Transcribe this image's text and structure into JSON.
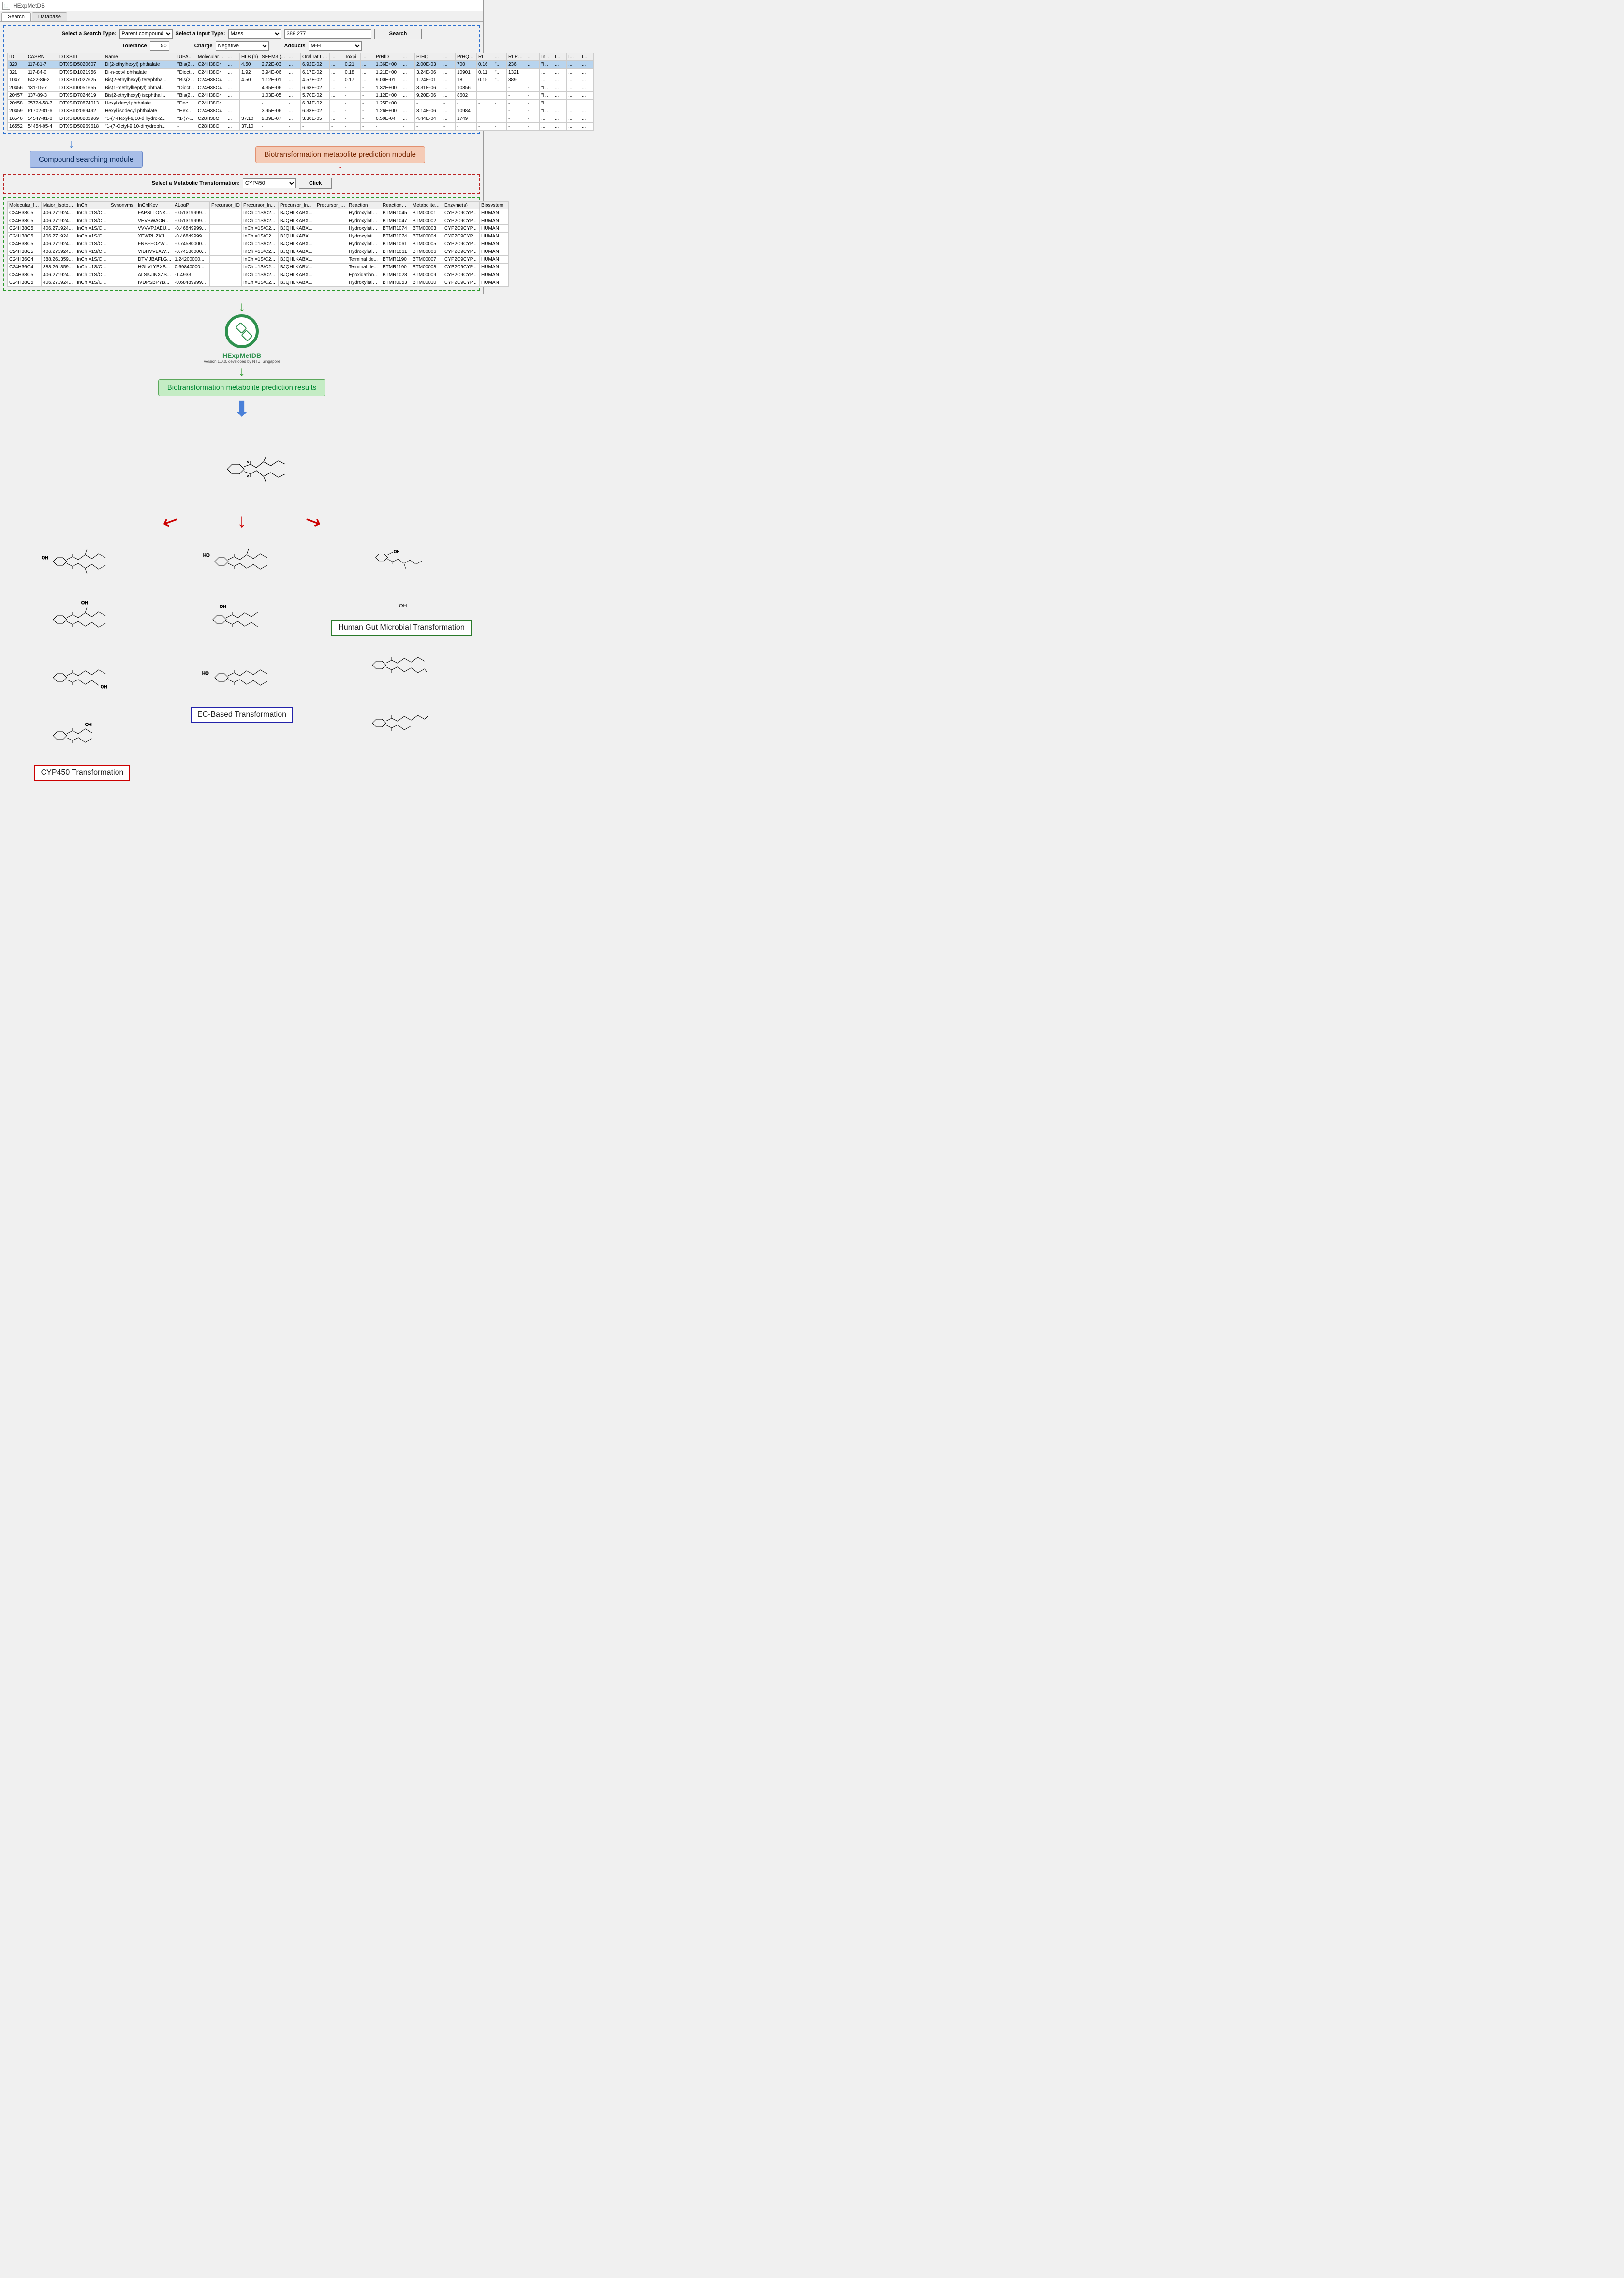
{
  "app": {
    "title": "HExpMetDB"
  },
  "tabs": {
    "search": "Search",
    "database": "Database"
  },
  "search": {
    "searchTypeLabel": "Select a Search Type:",
    "searchTypeValue": "Parent compound",
    "inputTypeLabel": "Select a Input Type:",
    "inputTypeValue": "Mass",
    "massValue": "389.277",
    "searchBtn": "Search",
    "tolLabel": "Tolerance",
    "tolValue": "50",
    "chargeLabel": "Charge",
    "chargeValue": "Negative",
    "adductsLabel": "Adducts",
    "adductsValue": "M-H"
  },
  "resultCols": [
    "ID",
    "CASRN",
    "DTXSID",
    "Name",
    "IUPA...",
    "Molecular f...",
    "...",
    "HLB (h)",
    "SEEM3 (...",
    "...",
    "Oral rat LD...",
    "...",
    "Toxpi",
    "...",
    "PrRfD",
    "...",
    "PrHQ",
    "...",
    "PrHQ...",
    "RI",
    "...",
    "RI Ra...",
    "...",
    "In...",
    "I...",
    "I...",
    "I..."
  ],
  "results": [
    {
      "id": "320",
      "cas": "117-81-7",
      "dtx": "DTXSID5020607",
      "name": "Di(2-ethylhexyl) phthalate",
      "iupa": "\"Bis(2...",
      "mf": "C24H38O4",
      "c7": "...",
      "hlb": "4.50",
      "seem": "2.72E-03",
      "c10": "...",
      "oral": "6.92E-02",
      "c12": "...",
      "toxpi": "0.21",
      "c14": "...",
      "prrfd": "1.36E+00",
      "c16": "...",
      "prhq": "2.00E-03",
      "c18": "...",
      "prhq2": "700",
      "ri": "0.16",
      "c21": "\"...",
      "rira": "236",
      "c23": "...",
      "i1": "\"I...",
      "i2": "...",
      "i3": "...",
      "i4": "..."
    },
    {
      "id": "321",
      "cas": "117-84-0",
      "dtx": "DTXSID1021956",
      "name": "Di-n-octyl phthalate",
      "iupa": "\"Dioct...",
      "mf": "C24H38O4",
      "c7": "...",
      "hlb": "1.92",
      "seem": "3.94E-06",
      "c10": "...",
      "oral": "6.17E-02",
      "c12": "...",
      "toxpi": "0.18",
      "c14": "...",
      "prrfd": "1.21E+00",
      "c16": "...",
      "prhq": "3.24E-06",
      "c18": "...",
      "prhq2": "10901",
      "ri": "0.11",
      "c21": "\"...",
      "rira": "1321",
      "c23": "",
      "i1": "...",
      "i2": "...",
      "i3": "...",
      "i4": "..."
    },
    {
      "id": "1047",
      "cas": "6422-86-2",
      "dtx": "DTXSID7027625",
      "name": "Bis(2-ethylhexyl) terephtha...",
      "iupa": "\"Bis(2...",
      "mf": "C24H38O4",
      "c7": "...",
      "hlb": "4.50",
      "seem": "1.12E-01",
      "c10": "...",
      "oral": "4.57E-02",
      "c12": "...",
      "toxpi": "0.17",
      "c14": "...",
      "prrfd": "9.00E-01",
      "c16": "...",
      "prhq": "1.24E-01",
      "c18": "...",
      "prhq2": "18",
      "ri": "0.15",
      "c21": "\"...",
      "rira": "389",
      "c23": "",
      "i1": "...",
      "i2": "...",
      "i3": "...",
      "i4": "..."
    },
    {
      "id": "20456",
      "cas": "131-15-7",
      "dtx": "DTXSID0051655",
      "name": "Bis(1-methylheptyl) phthal...",
      "iupa": "\"Dioct...",
      "mf": "C24H38O4",
      "c7": "...",
      "hlb": "",
      "seem": "4.35E-06",
      "c10": "...",
      "oral": "6.68E-02",
      "c12": "...",
      "toxpi": "-",
      "c14": "-",
      "prrfd": "1.32E+00",
      "c16": "...",
      "prhq": "3.31E-06",
      "c18": "...",
      "prhq2": "10856",
      "ri": "",
      "c21": "",
      "rira": "-",
      "c23": "-",
      "i1": "\"I...",
      "i2": "...",
      "i3": "...",
      "i4": "..."
    },
    {
      "id": "20457",
      "cas": "137-89-3",
      "dtx": "DTXSID7024619",
      "name": "Bis(2-ethylhexyl) isophthal...",
      "iupa": "\"Bis(2...",
      "mf": "C24H38O4",
      "c7": "...",
      "hlb": "",
      "seem": "1.03E-05",
      "c10": "...",
      "oral": "5.70E-02",
      "c12": "...",
      "toxpi": "-",
      "c14": "-",
      "prrfd": "1.12E+00",
      "c16": "...",
      "prhq": "9.20E-06",
      "c18": "...",
      "prhq2": "8602",
      "ri": "",
      "c21": "",
      "rira": "-",
      "c23": "-",
      "i1": "\"I...",
      "i2": "...",
      "i3": "...",
      "i4": "..."
    },
    {
      "id": "20458",
      "cas": "25724-58-7",
      "dtx": "DTXSID70874013",
      "name": "Hexyl decyl phthalate",
      "iupa": "\"Decyl...",
      "mf": "C24H38O4",
      "c7": "...",
      "hlb": "",
      "seem": "-",
      "c10": "-",
      "oral": "6.34E-02",
      "c12": "...",
      "toxpi": "-",
      "c14": "-",
      "prrfd": "1.25E+00",
      "c16": "...",
      "prhq": "-",
      "c18": "-",
      "prhq2": "-",
      "ri": "-",
      "c21": "-",
      "rira": "-",
      "c23": "-",
      "i1": "\"I...",
      "i2": "...",
      "i3": "...",
      "i4": "..."
    },
    {
      "id": "20459",
      "cas": "61702-81-6",
      "dtx": "DTXSID2069492",
      "name": "Hexyl isodecyl phthalate",
      "iupa": "\"Hexyl...",
      "mf": "C24H38O4",
      "c7": "...",
      "hlb": "",
      "seem": "3.95E-06",
      "c10": "...",
      "oral": "6.38E-02",
      "c12": "...",
      "toxpi": "-",
      "c14": "-",
      "prrfd": "1.26E+00",
      "c16": "...",
      "prhq": "3.14E-06",
      "c18": "...",
      "prhq2": "10984",
      "ri": "",
      "c21": "",
      "rira": "-",
      "c23": "-",
      "i1": "\"I...",
      "i2": "...",
      "i3": "...",
      "i4": "..."
    },
    {
      "id": "16546",
      "cas": "54547-81-8",
      "dtx": "DTXSID80202969",
      "name": "\"1-(7-Hexyl-9,10-dihydro-2...",
      "iupa": "\"1-(7-...",
      "mf": "C28H38O",
      "c7": "...",
      "hlb": "37.10",
      "seem": "2.89E-07",
      "c10": "...",
      "oral": "3.30E-05",
      "c12": "...",
      "toxpi": "-",
      "c14": "-",
      "prrfd": "6.50E-04",
      "c16": "...",
      "prhq": "4.44E-04",
      "c18": "...",
      "prhq2": "1749",
      "ri": "",
      "c21": "",
      "rira": "-",
      "c23": "-",
      "i1": "...",
      "i2": "...",
      "i3": "...",
      "i4": "..."
    },
    {
      "id": "16552",
      "cas": "54454-95-4",
      "dtx": "DTXSID50969618",
      "name": "\"1-(7-Octyl-9,10-dihydroph...",
      "iupa": "-",
      "mf": "C28H38O",
      "c7": "...",
      "hlb": "37.10",
      "seem": "-",
      "c10": "-",
      "oral": "-",
      "c12": "-",
      "toxpi": "-",
      "c14": "-",
      "prrfd": "-",
      "c16": "-",
      "prhq": "-",
      "c18": "-",
      "prhq2": "-",
      "ri": "-",
      "c21": "-",
      "rira": "-",
      "c23": "-",
      "i1": "...",
      "i2": "...",
      "i3": "...",
      "i4": "..."
    }
  ],
  "labels": {
    "compoundModule": "Compound searching module",
    "biotransModule": "Biotransformation metabolite prediction module",
    "predResults": "Biotransformation metabolite prediction results",
    "cyp": "CYP450 Transformation",
    "ec": "EC-Based Transformation",
    "gut": "Human Gut Microbial Transformation"
  },
  "biotrans": {
    "selectLabel": "Select a Metabolic Transformation:",
    "selectValue": "CYP450",
    "clickBtn": "Click"
  },
  "metabCols": [
    "Molecular_fo...",
    "Major_Isotop...",
    "InChI",
    "Synonyms",
    "InChIKey",
    "ALogP",
    "Precursor_ID",
    "Precursor_In...",
    "Precursor_In...",
    "Precursor_A...",
    "Reaction",
    "Reaction_ID",
    "Metabolite_ID",
    "Enzyme(s)",
    "Biosystem"
  ],
  "metab": [
    {
      "mf": "C24H38O5",
      "mi": "406.271924...",
      "inchi": "InChI=1S/C2...",
      "syn": "",
      "ikey": "FAPSLTONK...",
      "alogp": "-0.51319999...",
      "pid": "",
      "pin1": "InChI=1S/C2...",
      "pin2": "BJQHLKABX...",
      "pa": "",
      "rxn": "Hydroxylatio...",
      "rid": "BTMR1045",
      "mid": "BTM00001",
      "enz": "CYP2C9CYP...",
      "bio": "HUMAN"
    },
    {
      "mf": "C24H38O5",
      "mi": "406.271924...",
      "inchi": "InChI=1S/C2...",
      "syn": "",
      "ikey": "VEVSWAOR...",
      "alogp": "-0.51319999...",
      "pid": "",
      "pin1": "InChI=1S/C2...",
      "pin2": "BJQHLKABX...",
      "pa": "",
      "rxn": "Hydroxylatio...",
      "rid": "BTMR1047",
      "mid": "BTM00002",
      "enz": "CYP2C9CYP...",
      "bio": "HUMAN"
    },
    {
      "mf": "C24H38O5",
      "mi": "406.271924...",
      "inchi": "InChI=1S/C2...",
      "syn": "",
      "ikey": "VVVVPJAEU...",
      "alogp": "-0.46849999...",
      "pid": "",
      "pin1": "InChI=1S/C2...",
      "pin2": "BJQHLKABX...",
      "pa": "",
      "rxn": "Hydroxylatio...",
      "rid": "BTMR1074",
      "mid": "BTM00003",
      "enz": "CYP2C9CYP...",
      "bio": "HUMAN"
    },
    {
      "mf": "C24H38O5",
      "mi": "406.271924...",
      "inchi": "InChI=1S/C2...",
      "syn": "",
      "ikey": "XEWPUZKJ...",
      "alogp": "-0.46849999...",
      "pid": "",
      "pin1": "InChI=1S/C2...",
      "pin2": "BJQHLKABX...",
      "pa": "",
      "rxn": "Hydroxylatio...",
      "rid": "BTMR1074",
      "mid": "BTM00004",
      "enz": "CYP2C9CYP...",
      "bio": "HUMAN"
    },
    {
      "mf": "C24H38O5",
      "mi": "406.271924...",
      "inchi": "InChI=1S/C2...",
      "syn": "",
      "ikey": "FNBFFOZW...",
      "alogp": "-0.74580000...",
      "pid": "",
      "pin1": "InChI=1S/C2...",
      "pin2": "BJQHLKABX...",
      "pa": "",
      "rxn": "Hydroxylatio...",
      "rid": "BTMR1061",
      "mid": "BTM00005",
      "enz": "CYP2C9CYP...",
      "bio": "HUMAN"
    },
    {
      "mf": "C24H38O5",
      "mi": "406.271924...",
      "inchi": "InChI=1S/C2...",
      "syn": "",
      "ikey": "VIBHVVLXWI...",
      "alogp": "-0.74580000...",
      "pid": "",
      "pin1": "InChI=1S/C2...",
      "pin2": "BJQHLKABX...",
      "pa": "",
      "rxn": "Hydroxylatio...",
      "rid": "BTMR1061",
      "mid": "BTM00006",
      "enz": "CYP2C9CYP...",
      "bio": "HUMAN"
    },
    {
      "mf": "C24H36O4",
      "mi": "388.261359...",
      "inchi": "InChI=1S/C2...",
      "syn": "",
      "ikey": "DTVIJBAFLG...",
      "alogp": "1.24200000...",
      "pid": "",
      "pin1": "InChI=1S/C2...",
      "pin2": "BJQHLKABX...",
      "pa": "",
      "rxn": "Terminal de...",
      "rid": "BTMR1190",
      "mid": "BTM00007",
      "enz": "CYP2C9CYP...",
      "bio": "HUMAN"
    },
    {
      "mf": "C24H36O4",
      "mi": "388.261359...",
      "inchi": "InChI=1S/C2...",
      "syn": "",
      "ikey": "HGLVLYPXB...",
      "alogp": "0.69840000...",
      "pid": "",
      "pin1": "InChI=1S/C2...",
      "pin2": "BJQHLKABX...",
      "pa": "",
      "rxn": "Terminal de...",
      "rid": "BTMR1190",
      "mid": "BTM00008",
      "enz": "CYP2C9CYP...",
      "bio": "HUMAN"
    },
    {
      "mf": "C24H38O5",
      "mi": "406.271924...",
      "inchi": "InChI=1S/C2...",
      "syn": "",
      "ikey": "ALSKJINXZS...",
      "alogp": "-1.4933",
      "pid": "",
      "pin1": "InChI=1S/C2...",
      "pin2": "BJQHLKABX...",
      "pa": "",
      "rxn": "Epoxidation ...",
      "rid": "BTMR1028",
      "mid": "BTM00009",
      "enz": "CYP2C9CYP...",
      "bio": "HUMAN"
    },
    {
      "mf": "C24H38O5",
      "mi": "406.271924...",
      "inchi": "InChI=1S/C2...",
      "syn": "",
      "ikey": "IVDPSBPYB...",
      "alogp": "-0.68489999...",
      "pid": "",
      "pin1": "InChI=1S/C2...",
      "pin2": "BJQHLKABX...",
      "pa": "",
      "rxn": "Hydroxylatio...",
      "rid": "BTMR0053",
      "mid": "BTM00010",
      "enz": "CYP2C9CYP...",
      "bio": "HUMAN"
    }
  ],
  "logo": {
    "name": "HExpMetDB",
    "sub": "Version 1.0.0, developed by NTU, Singapore"
  }
}
